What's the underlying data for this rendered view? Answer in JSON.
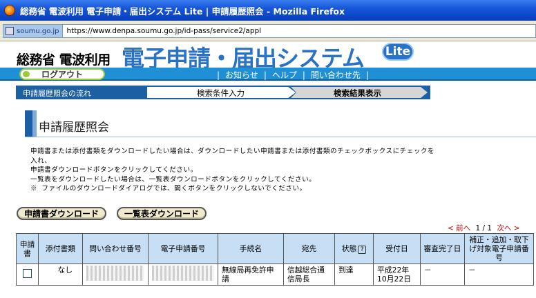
{
  "window": {
    "title": "総務省 電波利用 電子申請・届出システム Lite | 申請履歴照会 - Mozilla Firefox"
  },
  "addressbar": {
    "site": "soumu.go.jp",
    "url": "https://www.denpa.soumu.go.jp/id-pass/service2/appl"
  },
  "header": {
    "org": "総務省 電波利用",
    "system": "電子申請・届出システム",
    "badge": "Lite"
  },
  "nav": {
    "logout": "ログアウト",
    "links": [
      "お知らせ",
      "ヘルプ",
      "問い合わせ先"
    ]
  },
  "steps": {
    "flow": "申請履歴照会の流れ",
    "step1": "検索条件入力",
    "step2": "検索結果表示"
  },
  "page": {
    "title": "申請履歴照会",
    "instructions": [
      "申請書または添付書類をダウンロードしたい場合は、ダウンロードしたい申請書または添付書類のチェックボックスにチェックを",
      "入れ、",
      "申請書ダウンロードボタンをクリックしてください。",
      "一覧表をダウンロードしたい場合は、一覧表ダウンロードボタンをクリックしてください。",
      "※ ファイルのダウンロードダイアログでは、開くボタンをクリックしないでください。"
    ]
  },
  "buttons": {
    "download_app": "申請書ダウンロード",
    "download_list": "一覧表ダウンロード"
  },
  "pager": {
    "prev": "< 前へ",
    "status": "1 / 1",
    "next": "次へ >"
  },
  "table": {
    "headers": [
      "申請書",
      "添付書類",
      "問い合わせ番号",
      "電子申請番号",
      "手続名",
      "宛先",
      "状態",
      "受付日",
      "審査完了日",
      "補正・追加・取下げ対象電子申請番号"
    ],
    "rows": [
      {
        "attach": "なし",
        "procedure": "無線局再免許申請",
        "dest": "信越総合通信局長",
        "status": "到達",
        "date": "平成22年10月22日",
        "completed": "－",
        "target": "－"
      }
    ]
  }
}
